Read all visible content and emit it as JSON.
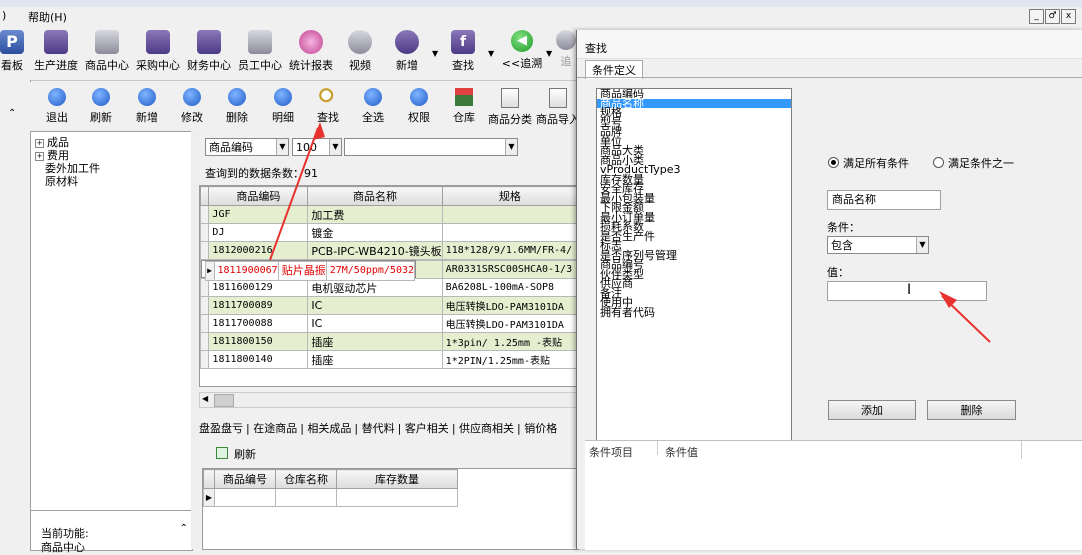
{
  "menu": {
    "paren": ")",
    "help": "帮助(H)"
  },
  "window_buttons": [
    "_",
    "♂",
    "x"
  ],
  "main_toolbar": [
    {
      "label": "P",
      "text": "看板"
    },
    {
      "label": "生产进度"
    },
    {
      "label": "商品中心"
    },
    {
      "label": "采购中心"
    },
    {
      "label": "财务中心"
    },
    {
      "label": "员工中心"
    },
    {
      "label": "统计报表"
    },
    {
      "label": "视频"
    },
    {
      "label": "新增"
    },
    {
      "label": "查找"
    },
    {
      "label": "<<追溯"
    },
    {
      "label": "追"
    }
  ],
  "sub_toolbar": [
    "退出",
    "刷新",
    "新增",
    "修改",
    "删除",
    "明细",
    "查找",
    "全选",
    "权限",
    "仓库",
    "商品分类",
    "商品导入"
  ],
  "tree": {
    "items": [
      "成品",
      "费用",
      "委外加工件",
      "原材料"
    ]
  },
  "current_function": {
    "label": "当前功能:",
    "value": "商品中心"
  },
  "filter": {
    "field": "商品编码",
    "operator": "100",
    "value": ""
  },
  "query_count": {
    "label": "查询到的数据条数：",
    "value": "91"
  },
  "grid": {
    "headers": [
      "商品编码",
      "商品名称",
      "规格"
    ],
    "rows": [
      [
        "JGF",
        "加工费",
        ""
      ],
      [
        "DJ",
        "镀金",
        ""
      ],
      [
        "1812000216",
        "PCB-IPC-WB4210-镜头板",
        "118*128/9/1.6MM/FR-4/"
      ],
      [
        "1811900067",
        "贴片晶振",
        "27M/50ppm/5032"
      ],
      [
        "1811600130",
        "CMOS传感器",
        "AR0331SRSC00SHCA0-1/3"
      ],
      [
        "1811600129",
        "电机驱动芯片",
        "BA6208L-100mA-SOP8"
      ],
      [
        "1811700089",
        "IC",
        "电压转换LDO-PAM3101DA"
      ],
      [
        "1811700088",
        "IC",
        "电压转换LDO-PAM3101DA"
      ],
      [
        "1811800150",
        "插座",
        "1*3pin/ 1.25mm -表贴"
      ],
      [
        "1811800140",
        "插座",
        "1*2PIN/1.25mm-表贴"
      ]
    ],
    "selected_index": 3
  },
  "bottom_tabs": [
    "盘盈盘亏",
    "在途商品",
    "相关成品",
    "替代料",
    "客户相关",
    "供应商相关",
    "销价格"
  ],
  "refresh_label": "刷新",
  "grid2": {
    "headers": [
      "商品编号",
      "仓库名称",
      "库存数量"
    ]
  },
  "dialog": {
    "title": "查找",
    "tab": "条件定义",
    "fields": [
      "商品编码",
      "商品名称",
      "规格",
      "型号",
      "品牌",
      "单位",
      "商品大类",
      "商品小类",
      "vProductType3",
      "库存数量",
      "安全库存",
      "最小包装量",
      "下限金额",
      "最小订单量",
      "损耗系数",
      "是否生产件",
      "标志",
      "是否序列号管理",
      "商品编号",
      "伙伴类型",
      "供应商",
      "备注",
      "使用中",
      "拥有者代码"
    ],
    "selected_field_index": 1,
    "radio_all": "满足所有条件",
    "radio_any": "满足条件之一",
    "field_name": "商品名称",
    "condition_label": "条件：",
    "condition_value": "包含",
    "value_label": "值：",
    "value_input": "",
    "add_button": "添加",
    "delete_button": "删除",
    "bottom_headers": [
      "条件项目",
      "条件值"
    ]
  },
  "colors": {
    "selected_row_text": "#e00000",
    "list_highlight": "#3399ff",
    "row_alt": "#e6eed0",
    "arrow": "#e8322d"
  }
}
